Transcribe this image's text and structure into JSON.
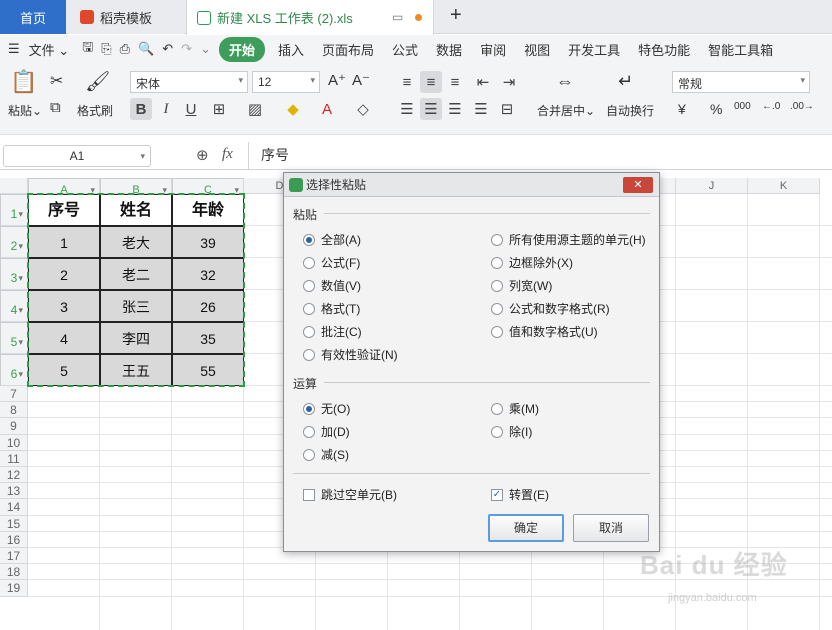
{
  "tabs": {
    "home": "首页",
    "templates": "稻壳模板",
    "document": "新建 XLS 工作表 (2).xls"
  },
  "menu": {
    "file": "文件",
    "items": [
      "开始",
      "插入",
      "页面布局",
      "公式",
      "数据",
      "审阅",
      "视图",
      "开发工具",
      "特色功能",
      "智能工具箱"
    ]
  },
  "ribbon": {
    "paste": "粘贴",
    "format_painter": "格式刷",
    "font_name": "宋体",
    "font_size": "12",
    "merge": "合并居中",
    "wrap": "自动换行",
    "number_format": "常规",
    "currency": "¥",
    "percent": "%",
    "thousands": "000"
  },
  "formula_bar": {
    "cell_ref": "A1",
    "fx": "fx",
    "content": "序号"
  },
  "grid": {
    "columns": [
      "A",
      "B",
      "C",
      "D",
      "E",
      "F",
      "G",
      "H",
      "I",
      "J",
      "K"
    ],
    "rows": [
      "1",
      "2",
      "3",
      "4",
      "5",
      "6",
      "7",
      "8",
      "9",
      "10",
      "11",
      "12",
      "13",
      "14",
      "15",
      "16",
      "17",
      "18",
      "19"
    ],
    "headers": [
      "序号",
      "姓名",
      "年龄"
    ],
    "data": [
      [
        "1",
        "老大",
        "39"
      ],
      [
        "2",
        "老二",
        "32"
      ],
      [
        "3",
        "张三",
        "26"
      ],
      [
        "4",
        "李四",
        "35"
      ],
      [
        "5",
        "王五",
        "55"
      ]
    ]
  },
  "dialog": {
    "title": "选择性粘贴",
    "paste_section": "粘贴",
    "paste_left": [
      "全部(A)",
      "公式(F)",
      "数值(V)",
      "格式(T)",
      "批注(C)",
      "有效性验证(N)"
    ],
    "paste_right": [
      "所有使用源主题的单元(H)",
      "边框除外(X)",
      "列宽(W)",
      "公式和数字格式(R)",
      "值和数字格式(U)"
    ],
    "op_section": "运算",
    "op_left": [
      "无(O)",
      "加(D)",
      "减(S)"
    ],
    "op_right": [
      "乘(M)",
      "除(I)"
    ],
    "skip_blanks": "跳过空单元(B)",
    "transpose": "转置(E)",
    "ok": "确定",
    "cancel": "取消"
  },
  "watermark": {
    "brand": "Bai du 经验",
    "url": "jingyan.baidu.com"
  },
  "colors": {
    "accent": "#3e9d5a",
    "home_tab": "#2f6fc9",
    "selection": "#2a9d44"
  }
}
